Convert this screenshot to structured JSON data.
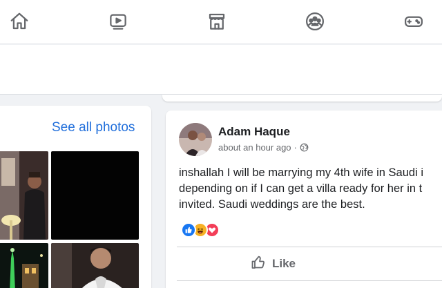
{
  "nav": {
    "items": [
      {
        "icon": "home-icon"
      },
      {
        "icon": "watch-video-icon"
      },
      {
        "icon": "marketplace-store-icon"
      },
      {
        "icon": "groups-icon"
      },
      {
        "icon": "gaming-controller-icon"
      }
    ]
  },
  "photos": {
    "see_all_label": "See all photos"
  },
  "post": {
    "author": "Adam Haque",
    "timestamp": "about an hour ago",
    "separator": "·",
    "privacy_icon": "globe-icon",
    "text_lines": [
      "inshallah I will be marrying my 4th wife in Saudi i",
      "depending on if I can get a villa ready for her in t",
      "invited. Saudi weddings are the best."
    ],
    "reactions": [
      "like",
      "haha",
      "love"
    ],
    "like_label": "Like"
  },
  "colors": {
    "link": "#216fdb",
    "like_reaction": "#1877f2",
    "love_reaction": "#f33e58",
    "haha_reaction": "#f7b125"
  }
}
